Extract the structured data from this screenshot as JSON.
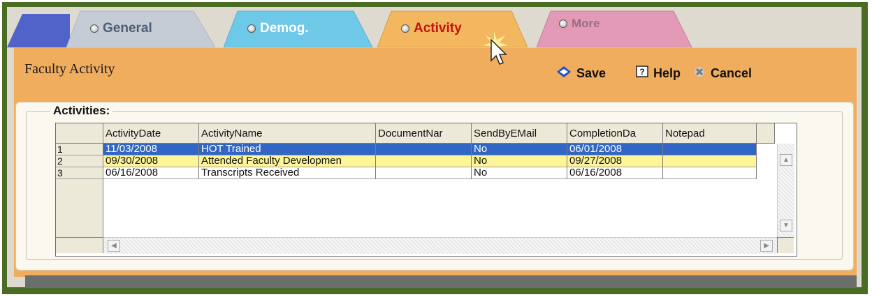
{
  "tabs": [
    {
      "label": "General",
      "color": "#c5ccd6",
      "text_color": "#4e5e74"
    },
    {
      "label": "Demog.",
      "color": "#6ec8e8",
      "text_color": "#ffffff"
    },
    {
      "label": "Activity",
      "color": "#f3b85f",
      "text_color": "#c41212"
    },
    {
      "label": "More",
      "color": "#e39ab6",
      "text_color": "#9a6d80"
    }
  ],
  "active_tab": "Activity",
  "page_title": "Faculty Activity",
  "toolbar": {
    "save_label": "Save",
    "help_label": "Help",
    "cancel_label": "Cancel"
  },
  "group_title": "Activities:",
  "columns": [
    "ActivityDate",
    "ActivityName",
    "DocumentNar",
    "SendByEMail",
    "CompletionDa",
    "Notepad"
  ],
  "rows": [
    {
      "num": "1",
      "ActivityDate": "11/03/2008",
      "ActivityName": "HOT Trained",
      "DocumentName": "",
      "SendByEMail": "No",
      "CompletionDate": "06/01/2008",
      "Notepad": "",
      "state": "selected"
    },
    {
      "num": "2",
      "ActivityDate": "09/30/2008",
      "ActivityName": "Attended Faculty Developmen",
      "DocumentName": "",
      "SendByEMail": "No",
      "CompletionDate": "09/27/2008",
      "Notepad": "",
      "state": "highlighted"
    },
    {
      "num": "3",
      "ActivityDate": "06/16/2008",
      "ActivityName": "Transcripts Received",
      "DocumentName": "",
      "SendByEMail": "No",
      "CompletionDate": "06/16/2008",
      "Notepad": "",
      "state": "normal"
    }
  ],
  "colors": {
    "frame": "#4a6b23",
    "panel": "#f1ad5e",
    "selected_row": "#3166c5",
    "highlight_row": "#fdf598"
  },
  "icons": [
    "save-icon",
    "help-icon",
    "cancel-icon",
    "mouse-cursor-icon"
  ]
}
